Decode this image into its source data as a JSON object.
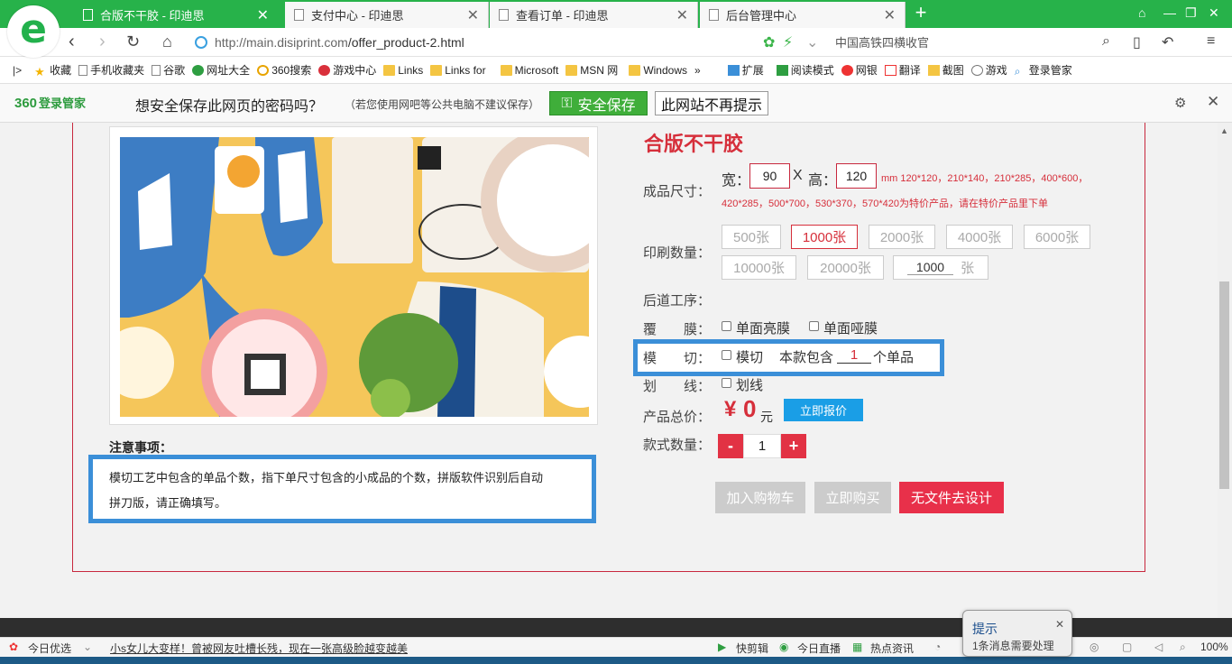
{
  "browser": {
    "tabs": [
      {
        "title": "合版不干胶 - 印迪思",
        "active": true
      },
      {
        "title": "支付中心 - 印迪思",
        "active": false
      },
      {
        "title": "查看订单 - 印迪思",
        "active": false
      },
      {
        "title": "后台管理中心",
        "active": false
      }
    ],
    "url_host": "http://main.disiprint.com",
    "url_path": "/offer_product-2.html",
    "search_text": "中国高铁四横收官"
  },
  "bookmarks": {
    "items": [
      "收藏",
      "手机收藏夹",
      "谷歌",
      "网址大全",
      "360搜索",
      "游戏中心",
      "Links",
      "Links for",
      "Microsoft",
      "MSN 网",
      "Windows"
    ],
    "more": "»",
    "right_items": [
      "扩展",
      "阅读模式",
      "网银",
      "翻译",
      "截图",
      "游戏",
      "登录管家"
    ]
  },
  "password_bar": {
    "brand": "360",
    "brand_sub": "登录管家",
    "question": "想安全保存此网页的密码吗？",
    "hint": "（若您使用网吧等公共电脑不建议保存）",
    "save_label": "安全保存",
    "never_label": "此网站不再提示"
  },
  "product": {
    "title": "合版不干胶",
    "size_label": "成品尺寸：",
    "width_label": "宽：",
    "width_value": "90",
    "x_label": "X",
    "height_label": "高：",
    "height_value": "120",
    "size_note_1": "mm 120*120，210*140，210*285，400*600，",
    "size_note_2": "420*285，500*700，530*370，570*420为特价产品，请在特价产品里下单",
    "qty_label": "印刷数量：",
    "qty_options": [
      "500张",
      "1000张",
      "2000张",
      "4000张",
      "6000张",
      "10000张",
      "20000张"
    ],
    "qty_selected": "1000张",
    "qty_custom_value": "1000",
    "qty_custom_unit": "张",
    "post_label": "后道工序：",
    "laminate_label": "覆　　膜：",
    "laminate_options": [
      "单面亮膜",
      "单面哑膜"
    ],
    "diecut_label": "模　　切：",
    "diecut_option": "模切",
    "diecut_text_pre": "本款包含",
    "diecut_count": "1",
    "diecut_text_post": "个单品",
    "score_label": "划　　线：",
    "score_option": "划线",
    "total_label": "产品总价：",
    "price_symbol": "¥",
    "price_value": "0",
    "price_unit": "元",
    "quote_button": "立即报价",
    "styles_label": "款式数量：",
    "styles_minus": "-",
    "styles_value": "1",
    "styles_plus": "+",
    "add_cart": "加入购物车",
    "buy_now": "立即购买",
    "design": "无文件去设计"
  },
  "notes": {
    "title": "注意事项：",
    "text_line1": "模切工艺中包含的单品个数，指下单尺寸包含的小成品的个数，拼版软件识别后自动",
    "text_line2": "拼刀版，请正确填写。"
  },
  "statusbar": {
    "left": "今日优选",
    "headline": "小s女儿大变样！曾被网友吐槽长残，现在一张高级脸越变越美",
    "items": [
      "快剪辑",
      "今日直播",
      "热点资讯"
    ],
    "zoom": "100%"
  },
  "popup": {
    "title": "提示",
    "body": "1条消息需要处理"
  },
  "colors": {
    "brand_green": "#27b24a",
    "accent_red": "#d62f3b",
    "highlight_blue": "#3b8fd8",
    "quote_blue": "#1a9ee6"
  }
}
